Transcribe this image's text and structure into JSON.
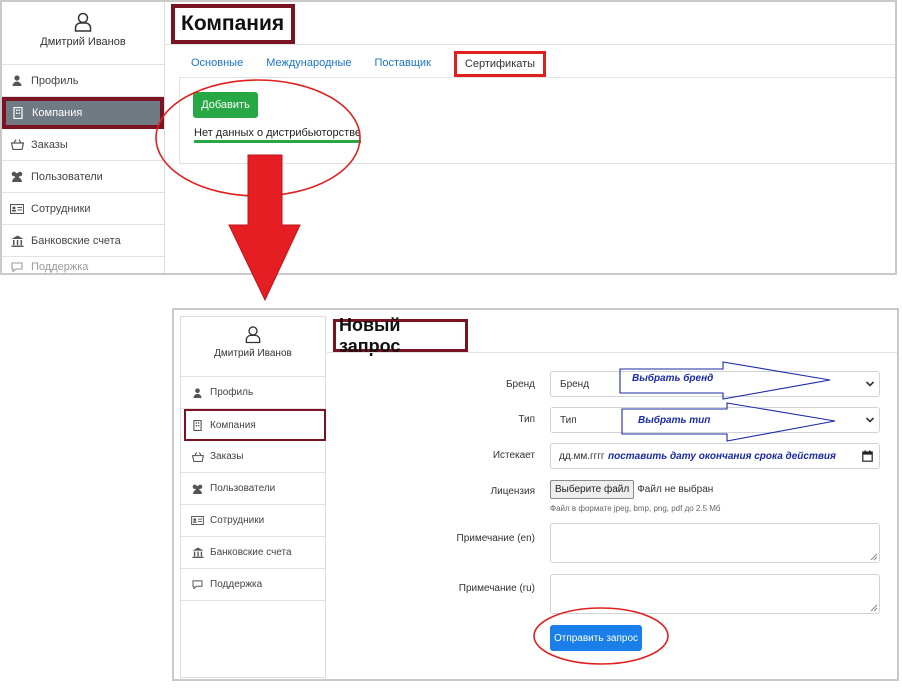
{
  "screen_before": {
    "user": {
      "name": "Дмитрий Иванов",
      "icon": "user-icon"
    },
    "sidebar": {
      "items": [
        {
          "label": "Профиль",
          "icon": "person-icon"
        },
        {
          "label": "Компания",
          "icon": "building-icon",
          "active": true
        },
        {
          "label": "Заказы",
          "icon": "basket-icon"
        },
        {
          "label": "Пользователи",
          "icon": "users-icon"
        },
        {
          "label": "Сотрудники",
          "icon": "id-card-icon"
        },
        {
          "label": "Банковские счета",
          "icon": "bank-icon"
        },
        {
          "label": "Поддержка",
          "icon": "chat-icon"
        }
      ]
    },
    "page_title": "Компания",
    "tabs": [
      {
        "label": "Основные"
      },
      {
        "label": "Международные"
      },
      {
        "label": "Поставщик"
      },
      {
        "label": "Сертификаты",
        "selected": true
      }
    ],
    "add_button_label": "Добавить",
    "empty_text": "Нет данных о дистрибьюторстве"
  },
  "screen_after": {
    "user": {
      "name": "Дмитрий Иванов",
      "icon": "user-icon"
    },
    "sidebar": {
      "items": [
        {
          "label": "Профиль",
          "icon": "person-icon"
        },
        {
          "label": "Компания",
          "icon": "building-icon",
          "active": true
        },
        {
          "label": "Заказы",
          "icon": "basket-icon"
        },
        {
          "label": "Пользователи",
          "icon": "users-icon"
        },
        {
          "label": "Сотрудники",
          "icon": "id-card-icon"
        },
        {
          "label": "Банковские счета",
          "icon": "bank-icon"
        },
        {
          "label": "Поддержка",
          "icon": "chat-icon"
        }
      ]
    },
    "page_title": "Новый запрос",
    "form": {
      "brand": {
        "label": "Бренд",
        "value": "Бренд",
        "annotation": "Выбрать бренд"
      },
      "type": {
        "label": "Тип",
        "value": "Тип",
        "annotation": "Выбрать тип"
      },
      "expires": {
        "label": "Истекает",
        "placeholder": "дд.мм.гггг",
        "annotation": "поставить дату окончания срока действия"
      },
      "license": {
        "label": "Лицензия",
        "button_label": "Выберите файл",
        "status": "Файл не выбран",
        "hint": "Файл в формате jpeg, bmp, png, pdf до 2.5 Mб"
      },
      "note_en": {
        "label": "Примечание (en)"
      },
      "note_ru": {
        "label": "Примечание (ru)"
      },
      "submit_label": "Отправить запрос"
    }
  },
  "colors": {
    "annotation_box": "#7a1422",
    "annotation_red": "#e0201e",
    "annotation_blue": "#1b2aa6",
    "primary_blue": "#1a7fe8",
    "success_green": "#28a745",
    "link_blue": "#1a73c8",
    "active_sidebar_bg": "#707a83"
  }
}
